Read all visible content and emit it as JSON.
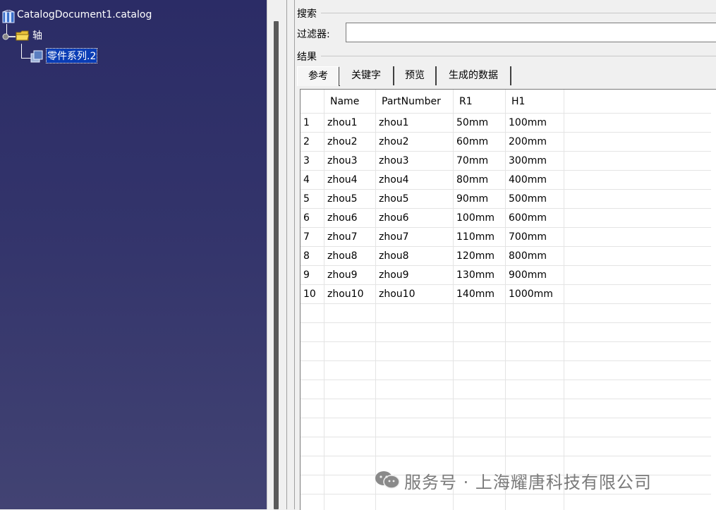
{
  "tree": {
    "root_label": "CatalogDocument1.catalog",
    "child_label": "轴",
    "grandchild_label": "零件系列.2"
  },
  "search": {
    "group_title": "搜索",
    "filter_label": "过滤器:",
    "filter_value": ""
  },
  "results": {
    "group_title": "结果",
    "tabs": [
      "参考",
      "关键字",
      "预览",
      "生成的数据"
    ],
    "columns": [
      "",
      "Name",
      "PartNumber",
      "R1",
      "H1"
    ],
    "rows": [
      [
        "1",
        "zhou1",
        "zhou1",
        "50mm",
        "100mm"
      ],
      [
        "2",
        "zhou2",
        "zhou2",
        "60mm",
        "200mm"
      ],
      [
        "3",
        "zhou3",
        "zhou3",
        "70mm",
        "300mm"
      ],
      [
        "4",
        "zhou4",
        "zhou4",
        "80mm",
        "400mm"
      ],
      [
        "5",
        "zhou5",
        "zhou5",
        "90mm",
        "500mm"
      ],
      [
        "6",
        "zhou6",
        "zhou6",
        "100mm",
        "600mm"
      ],
      [
        "7",
        "zhou7",
        "zhou7",
        "110mm",
        "700mm"
      ],
      [
        "8",
        "zhou8",
        "zhou8",
        "120mm",
        "800mm"
      ],
      [
        "9",
        "zhou9",
        "zhou9",
        "130mm",
        "900mm"
      ],
      [
        "10",
        "zhou10",
        "zhou10",
        "140mm",
        "1000mm"
      ]
    ]
  },
  "watermark": {
    "text": "服务号 · 上海耀唐科技有限公司",
    "icon": "wechat-icon"
  },
  "colors": {
    "tree_bg_top": "#2b2c66",
    "tree_bg_bottom": "#424373",
    "selection": "#0a3db5"
  }
}
